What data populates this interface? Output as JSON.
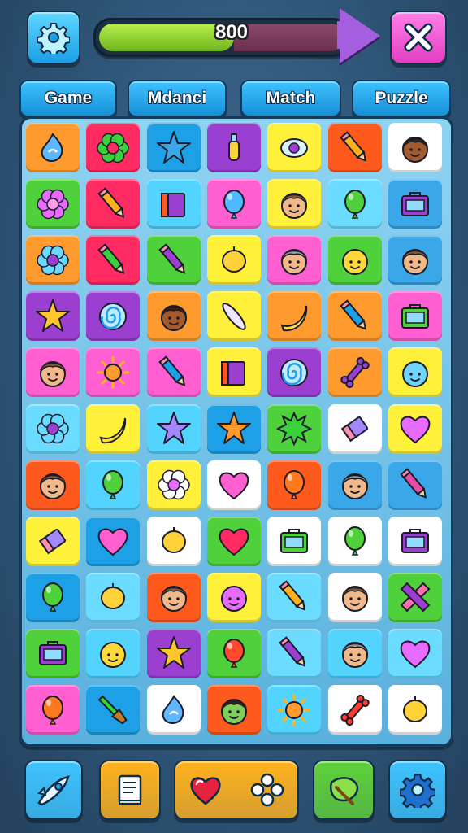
{
  "header": {
    "score": "800",
    "progress": 0.55,
    "settings_icon": "gear-icon",
    "close_icon": "close-icon"
  },
  "tabs": [
    {
      "label": "Game"
    },
    {
      "label": "Mdanci"
    },
    {
      "label": "Match"
    },
    {
      "label": "Puzzle"
    }
  ],
  "board": {
    "columns": 7,
    "rows": 11,
    "tiles": [
      [
        {
          "c": "#ff9a2e",
          "i": "drop"
        },
        {
          "c": "#ff2b62",
          "i": "flower"
        },
        {
          "c": "#1ea0e6",
          "i": "star-blob"
        },
        {
          "c": "#9b3fd0",
          "i": "bottle"
        },
        {
          "c": "#fff03a",
          "i": "eye"
        },
        {
          "c": "#ff5a1e",
          "i": "pencil"
        },
        {
          "c": "#ffffff",
          "i": "face-brown"
        }
      ],
      [
        {
          "c": "#4fd13b",
          "i": "flower-pink"
        },
        {
          "c": "#ff2b62",
          "i": "pencil"
        },
        {
          "c": "#52d4ff",
          "i": "book"
        },
        {
          "c": "#ff5fd0",
          "i": "balloon-blue"
        },
        {
          "c": "#fff03a",
          "i": "face-tan"
        },
        {
          "c": "#6bdcff",
          "i": "balloon-green"
        },
        {
          "c": "#3aa8e8",
          "i": "case"
        }
      ],
      [
        {
          "c": "#ff9a2e",
          "i": "flower-blue"
        },
        {
          "c": "#ff2b62",
          "i": "pencil-green"
        },
        {
          "c": "#4fd13b",
          "i": "pencil-purple"
        },
        {
          "c": "#fff03a",
          "i": "lemon"
        },
        {
          "c": "#ff5fd0",
          "i": "face-grey"
        },
        {
          "c": "#4fd13b",
          "i": "face-yellow"
        },
        {
          "c": "#3aa8e8",
          "i": "face-tan"
        }
      ],
      [
        {
          "c": "#9b3fd0",
          "i": "star-yellow"
        },
        {
          "c": "#9b3fd0",
          "i": "swirl"
        },
        {
          "c": "#ff9a2e",
          "i": "face-brown"
        },
        {
          "c": "#fff03a",
          "i": "feather"
        },
        {
          "c": "#ff9a2e",
          "i": "banana"
        },
        {
          "c": "#ff9a2e",
          "i": "pencil-blue"
        },
        {
          "c": "#ff5fd0",
          "i": "case-green"
        }
      ],
      [
        {
          "c": "#ff5fd0",
          "i": "face-tan"
        },
        {
          "c": "#ff5fd0",
          "i": "sun"
        },
        {
          "c": "#ff5fd0",
          "i": "pencil-blue"
        },
        {
          "c": "#fff03a",
          "i": "book"
        },
        {
          "c": "#9b3fd0",
          "i": "swirl"
        },
        {
          "c": "#ff9a2e",
          "i": "bone"
        },
        {
          "c": "#fff03a",
          "i": "face-blue"
        }
      ],
      [
        {
          "c": "#6bdcff",
          "i": "flower-blue"
        },
        {
          "c": "#fff03a",
          "i": "banana"
        },
        {
          "c": "#52d4ff",
          "i": "star-purple"
        },
        {
          "c": "#1ea0e6",
          "i": "star-orange"
        },
        {
          "c": "#4fd13b",
          "i": "splat"
        },
        {
          "c": "#ffffff",
          "i": "eraser"
        },
        {
          "c": "#fff03a",
          "i": "heart-purple"
        }
      ],
      [
        {
          "c": "#ff5a1e",
          "i": "face-tan"
        },
        {
          "c": "#52d4ff",
          "i": "balloon-green"
        },
        {
          "c": "#fff03a",
          "i": "flower-white"
        },
        {
          "c": "#ffffff",
          "i": "heart-pink"
        },
        {
          "c": "#ff5a1e",
          "i": "balloon-orange"
        },
        {
          "c": "#3aa8e8",
          "i": "face-grey"
        },
        {
          "c": "#3aa8e8",
          "i": "pencil-pink"
        }
      ],
      [
        {
          "c": "#fff03a",
          "i": "eraser"
        },
        {
          "c": "#1ea0e6",
          "i": "heart-pink"
        },
        {
          "c": "#ffffff",
          "i": "lemon"
        },
        {
          "c": "#4fd13b",
          "i": "heart-red"
        },
        {
          "c": "#ffffff",
          "i": "case-green"
        },
        {
          "c": "#ffffff",
          "i": "balloon-green"
        },
        {
          "c": "#ffffff",
          "i": "case"
        }
      ],
      [
        {
          "c": "#1ea0e6",
          "i": "balloon-green"
        },
        {
          "c": "#6bdcff",
          "i": "lemon"
        },
        {
          "c": "#ff5a1e",
          "i": "face-tan"
        },
        {
          "c": "#fff03a",
          "i": "face-pink"
        },
        {
          "c": "#6bdcff",
          "i": "pencil"
        },
        {
          "c": "#ffffff",
          "i": "face-tan"
        },
        {
          "c": "#4fd13b",
          "i": "star-pink"
        }
      ],
      [
        {
          "c": "#4fd13b",
          "i": "case-purple"
        },
        {
          "c": "#52d4ff",
          "i": "face-yellow"
        },
        {
          "c": "#9b3fd0",
          "i": "star-yellow"
        },
        {
          "c": "#4fd13b",
          "i": "balloon-red"
        },
        {
          "c": "#6bdcff",
          "i": "pencil-purple"
        },
        {
          "c": "#52d4ff",
          "i": "face-grey"
        },
        {
          "c": "#6bdcff",
          "i": "heart-purple"
        }
      ],
      [
        {
          "c": "#ff5fd0",
          "i": "balloon-orange"
        },
        {
          "c": "#1ea0e6",
          "i": "brush"
        },
        {
          "c": "#ffffff",
          "i": "drop"
        },
        {
          "c": "#ff5a1e",
          "i": "face-green"
        },
        {
          "c": "#52d4ff",
          "i": "sun"
        },
        {
          "c": "#ffffff",
          "i": "bone-red"
        },
        {
          "c": "#ffffff",
          "i": "lemon"
        }
      ]
    ]
  },
  "dock": [
    {
      "icon": "rocket-icon",
      "color": "#3ec3ff"
    },
    {
      "icon": "book-icon",
      "color": "#ffb21e"
    },
    {
      "icon": "heart-icon",
      "color": "#ffb21e"
    },
    {
      "icon": "leaf-icon",
      "color": "#5fd13b"
    },
    {
      "icon": "gear-icon",
      "color": "#3ec3ff"
    }
  ]
}
